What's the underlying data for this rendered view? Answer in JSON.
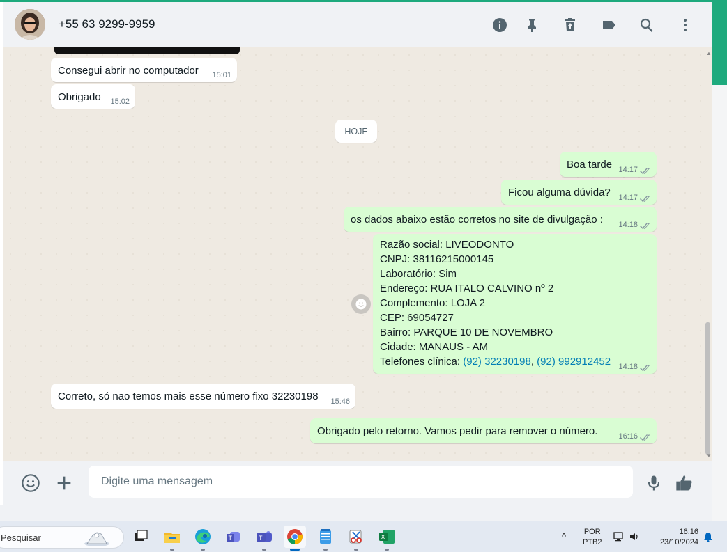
{
  "header": {
    "contact_name": "+55 63 9299-9959"
  },
  "chat": {
    "date_separator": "HOJE",
    "messages": [
      {
        "text": "Consegui abrir no computador",
        "time": "15:01",
        "direction": "in"
      },
      {
        "text": "Obrigado",
        "time": "15:02",
        "direction": "in"
      },
      {
        "text": "Boa tarde",
        "time": "14:17",
        "direction": "out"
      },
      {
        "text": "Ficou alguma dúvida?",
        "time": "14:17",
        "direction": "out"
      },
      {
        "text": "os dados abaixo estão corretos no site de divulgação :",
        "time": "14:18",
        "direction": "out"
      },
      {
        "lines": [
          "Razão social: LIVEODONTO",
          "CNPJ: 38116215000145",
          "Laboratório: Sim",
          "Endereço: RUA ITALO CALVINO nº 2",
          "Complemento: LOJA 2",
          "CEP: 69054727",
          "Bairro: PARQUE 10 DE NOVEMBRO",
          "Cidade: MANAUS - AM"
        ],
        "phones_label": "Telefones clínica: ",
        "phone_1": "(92) 32230198",
        "phone_sep": ", ",
        "phone_2": "(92) 992912452",
        "time": "14:18",
        "direction": "out"
      },
      {
        "text": "Correto, só nao temos mais esse número fixo 32230198",
        "time": "15:46",
        "direction": "in"
      },
      {
        "text": "Obrigado pelo retorno. Vamos pedir para remover o número.",
        "time": "16:16",
        "direction": "out"
      }
    ]
  },
  "footer": {
    "input_placeholder": "Digite uma mensagem"
  },
  "taskbar": {
    "search_label": "Pesquisar",
    "language": "POR",
    "keyboard": "PTB2",
    "time": "16:16",
    "date": "23/10/2024"
  },
  "colors": {
    "outgoing_bubble": "#d9fdd3",
    "incoming_bubble": "#ffffff",
    "chat_background": "#efeae2",
    "link": "#027eb5",
    "accent": "#1eaa7d"
  }
}
